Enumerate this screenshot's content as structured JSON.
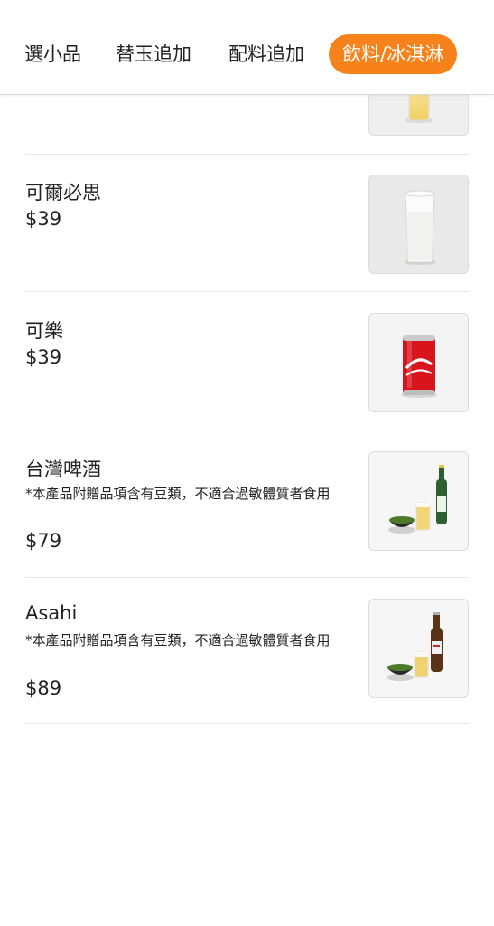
{
  "tabs": [
    {
      "label": "選小品",
      "active": false
    },
    {
      "label": "替玉追加",
      "active": false
    },
    {
      "label": "配料追加",
      "active": false
    },
    {
      "label": "飲料/冰淇淋",
      "active": true
    }
  ],
  "accent_color": "#f7821b",
  "items": [
    {
      "name": "可爾必思",
      "price": "$39",
      "image": "calpis-glass"
    },
    {
      "name": "可樂",
      "price": "$39",
      "image": "coca-cola-can"
    },
    {
      "name": "台灣啤酒",
      "note": "*本產品附贈品項含有豆類，不適合過敏體質者食用",
      "price": "$79",
      "image": "taiwan-beer-set"
    },
    {
      "name": "Asahi",
      "note": "*本產品附贈品項含有豆類，不適合過敏體質者食用",
      "price": "$89",
      "image": "asahi-beer-set"
    }
  ]
}
